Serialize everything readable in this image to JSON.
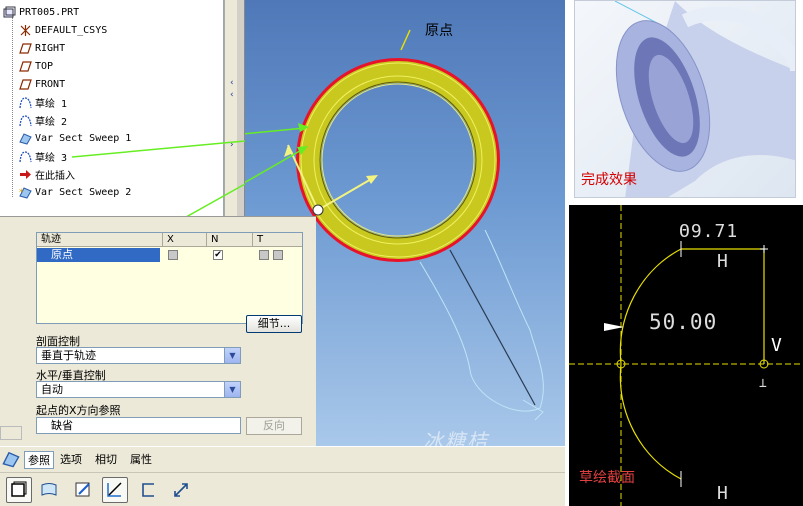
{
  "model_tree": {
    "root": "PRT005.PRT",
    "items": [
      {
        "label": "DEFAULT_CSYS",
        "icon": "csys-icon"
      },
      {
        "label": "RIGHT",
        "icon": "datum-plane-icon"
      },
      {
        "label": "TOP",
        "icon": "datum-plane-icon"
      },
      {
        "label": "FRONT",
        "icon": "datum-plane-icon"
      },
      {
        "label": "草绘 1",
        "icon": "sketch-icon"
      },
      {
        "label": "草绘 2",
        "icon": "sketch-icon"
      },
      {
        "label": "Var Sect Sweep 1",
        "icon": "sweep-icon"
      },
      {
        "label": "草绘 3",
        "icon": "sketch-icon"
      },
      {
        "label": "在此插入",
        "icon": "insert-arrow-icon"
      },
      {
        "label": "Var Sect Sweep 2",
        "icon": "sweep-new-icon"
      }
    ]
  },
  "viewport": {
    "origin_annotation": "原点",
    "watermark": "冰糖桔"
  },
  "dashboard": {
    "trajectory_table": {
      "headers": [
        "轨迹",
        "X",
        "N",
        "T"
      ],
      "rows": [
        {
          "name": "原点",
          "x_checked": false,
          "n_checked": true,
          "t_checked": false
        }
      ]
    },
    "detail_button": "细节...",
    "section_control": {
      "label": "剖面控制",
      "value": "垂直于轨迹"
    },
    "hv_control": {
      "label": "水平/垂直控制",
      "value": "自动"
    },
    "x_ref": {
      "label": "起点的X方向参照",
      "value": "缺省"
    },
    "flip_button": "反向",
    "tabs": [
      "参照",
      "选项",
      "相切",
      "属性"
    ]
  },
  "toolbar": {
    "icons": [
      "solid-icon",
      "surface-icon",
      "sketch-tool-icon",
      "constant-section-icon",
      "remove-material-icon",
      "thicken-icon"
    ]
  },
  "result_panel": {
    "label": "完成效果"
  },
  "sketch_panel": {
    "label": "草绘截面",
    "dim_top": "Θ9.71",
    "dim_center": "50.00",
    "vertical_constraint": "V"
  },
  "colors": {
    "viewport_top": "#4f78b8",
    "ring_outline": "#e8122a",
    "ring_fill": "#c8c81e",
    "selection": "#316ac5",
    "arrow_green": "#66ee22",
    "annotation_red": "#d40000"
  }
}
